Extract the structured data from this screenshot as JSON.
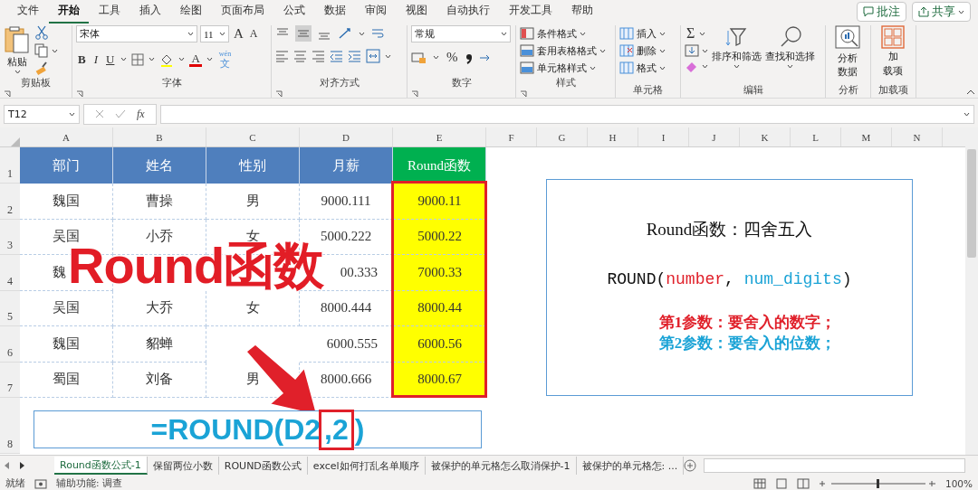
{
  "menu_tabs": [
    {
      "label": "文件",
      "selected": false
    },
    {
      "label": "开始",
      "selected": true
    },
    {
      "label": "工具",
      "selected": false
    },
    {
      "label": "插入",
      "selected": false
    },
    {
      "label": "绘图",
      "selected": false
    },
    {
      "label": "页面布局",
      "selected": false
    },
    {
      "label": "公式",
      "selected": false
    },
    {
      "label": "数据",
      "selected": false
    },
    {
      "label": "审阅",
      "selected": false
    },
    {
      "label": "视图",
      "selected": false
    },
    {
      "label": "自动执行",
      "selected": false
    },
    {
      "label": "开发工具",
      "selected": false
    },
    {
      "label": "帮助",
      "selected": false
    }
  ],
  "header_buttons": [
    {
      "label": "批注",
      "kind": "comment"
    },
    {
      "label": "共享",
      "kind": "share"
    }
  ],
  "ribbon": {
    "clipboard": {
      "label": "剪贴板",
      "paste": "粘贴"
    },
    "font": {
      "label": "字体",
      "family": "宋体",
      "size": "11",
      "grow": "A",
      "shrink": "A",
      "bold": "B",
      "italic": "I",
      "underline": "U",
      "font_color": "A",
      "phonetic_top": "wén",
      "phonetic_bottom": "文"
    },
    "alignment": {
      "label": "对齐方式"
    },
    "number": {
      "label": "数字",
      "format": "常规",
      "percent": "%"
    },
    "styles": {
      "label": "样式",
      "items": [
        "条件格式",
        "套用表格格式",
        "单元格样式"
      ]
    },
    "cells": {
      "label": "单元格",
      "items": [
        "插入",
        "删除",
        "格式"
      ]
    },
    "editing": {
      "label": "编辑",
      "sum": "Σ",
      "sort": "排序和筛选",
      "find": "查找和选择"
    },
    "analysis": {
      "label": "分析",
      "button": "分析数据"
    },
    "addins": {
      "label": "加载项",
      "button_top": "加",
      "button_bottom": "载项"
    }
  },
  "formula_bar": {
    "name_box": "T12",
    "fx": "fx"
  },
  "columns": [
    "A",
    "B",
    "C",
    "D",
    "E",
    "F",
    "G",
    "H",
    "I",
    "J",
    "K",
    "L",
    "M",
    "N"
  ],
  "row_numbers": [
    "1",
    "2",
    "3",
    "4",
    "5",
    "6",
    "7",
    "8"
  ],
  "table": {
    "headers": [
      "部门",
      "姓名",
      "性别",
      "月薪",
      "Round函数"
    ],
    "rows": [
      [
        "魏国",
        "曹操",
        "男",
        "9000.111",
        "9000.11"
      ],
      [
        "吴国",
        "小乔",
        "女",
        "5000.222",
        "5000.22"
      ],
      [
        "魏",
        null,
        null,
        "00.333",
        "7000.33"
      ],
      [
        "吴国",
        "大乔",
        "女",
        "8000.444",
        "8000.44"
      ],
      [
        "魏国",
        "貂蝉",
        null,
        "6000.555",
        "6000.56"
      ],
      [
        "蜀国",
        "刘备",
        "男",
        "8000.666",
        "8000.67"
      ]
    ]
  },
  "overlay_title": "Round函数",
  "formula_parts": [
    {
      "text": "=ROUND(D2",
      "highlighted": false
    },
    {
      "text": ",2",
      "highlighted": true
    },
    {
      "text": ")",
      "highlighted": false
    }
  ],
  "note_box": {
    "title": "Round函数：四舍五入",
    "syntax": [
      {
        "text": "ROUND(",
        "color": "#111111"
      },
      {
        "text": "number",
        "color": "#e0202a"
      },
      {
        "text": ", ",
        "color": "#111111"
      },
      {
        "text": "num_digits",
        "color": "#1aa3d6"
      },
      {
        "text": ")",
        "color": "#111111"
      }
    ],
    "notes": [
      {
        "text": "第1参数：要舍入的数字；",
        "color": "#e0202a"
      },
      {
        "text": "第2参数：要舍入的位数；",
        "color": "#1aa3d6"
      }
    ]
  },
  "sheet_tabs": [
    {
      "label": "Round函数公式-1",
      "selected": true
    },
    {
      "label": "保留两位小数",
      "selected": false
    },
    {
      "label": "ROUND函数公式",
      "selected": false
    },
    {
      "label": "excel如何打乱名单顺序",
      "selected": false
    },
    {
      "label": "被保护的单元格怎么取消保护-1",
      "selected": false
    },
    {
      "label": "被保护的单元格怎: ...",
      "selected": false
    }
  ],
  "status_bar": {
    "ready": "就绪",
    "accessibility": "辅助功能: 调查",
    "zoom": "100%"
  }
}
